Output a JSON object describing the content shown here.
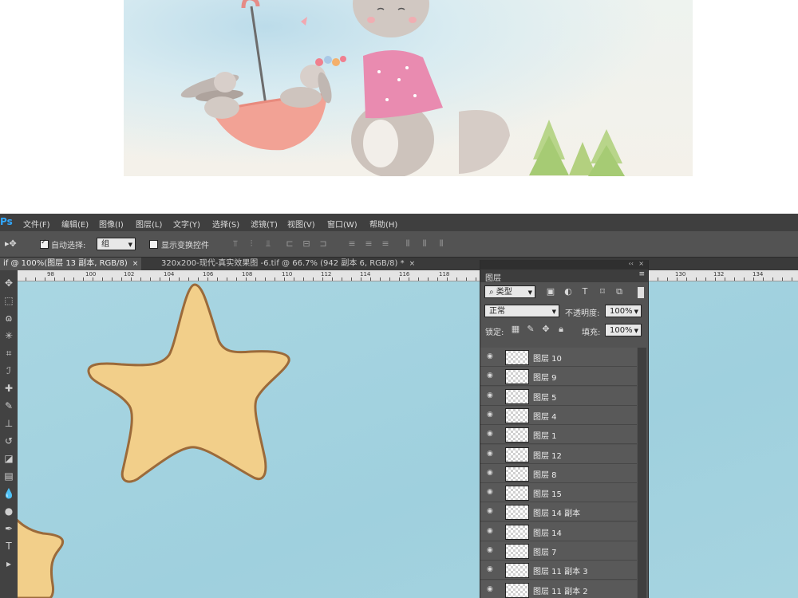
{
  "menu": {
    "logo": "Ps",
    "items": [
      "文件(F)",
      "编辑(E)",
      "图像(I)",
      "图层(L)",
      "文字(Y)",
      "选择(S)",
      "滤镜(T)",
      "视图(V)",
      "窗口(W)",
      "帮助(H)"
    ]
  },
  "options": {
    "auto_select_label": "自动选择:",
    "auto_select_value": "组",
    "transform_label": "显示变换控件"
  },
  "tabs": [
    {
      "label": "if @ 100%(图层 13 副本, RGB/8)",
      "close": "×"
    },
    {
      "label": "320x200-现代-真实效果图 -6.tif @ 66.7% (942 副本 6, RGB/8) *",
      "close": "×"
    }
  ],
  "ruler": {
    "ticks": [
      "98",
      "100",
      "102",
      "104",
      "106",
      "108",
      "110",
      "112",
      "114",
      "116",
      "118",
      "130",
      "132",
      "134"
    ]
  },
  "layers_panel": {
    "collapse": "‹‹",
    "close": "×",
    "title": "图层",
    "filter_kind": "类型",
    "blend_mode": "正常",
    "opacity_label": "不透明度:",
    "opacity_value": "100%",
    "lock_label": "锁定:",
    "fill_label": "填充:",
    "fill_value": "100%",
    "layers": [
      "图层 10",
      "图层 9",
      "图层 5",
      "图层 4",
      "图层 1",
      "图层 12",
      "图层 8",
      "图层 15",
      "图层 14 副本",
      "图层 14",
      "图层 7",
      "图层 11 副本 3",
      "图层 11 副本 2"
    ]
  },
  "colors": {
    "canvas_bg": "#a6d4e0",
    "star_fill": "#f2cf8a",
    "star_outline": "#9b6a3a",
    "ui_dark": "#3f3f3f",
    "ui_mid": "#535353"
  }
}
